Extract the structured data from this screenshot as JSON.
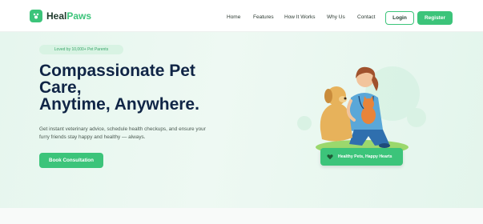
{
  "brand": {
    "name_primary": "Heal",
    "name_accent": "Paws",
    "accent_color": "#3cc47a"
  },
  "nav": {
    "items": [
      {
        "label": "Home"
      },
      {
        "label": "Features"
      },
      {
        "label": "How It Works"
      },
      {
        "label": "Why Us"
      },
      {
        "label": "Contact"
      }
    ],
    "login_label": "Login",
    "register_label": "Register"
  },
  "hero": {
    "badge": "Loved by 10,000+ Pet Parents",
    "headline_line1": "Compassionate Pet",
    "headline_line2": "Care,",
    "headline_line3": "Anytime, Anywhere.",
    "subtext_line1": "Get instant veterinary advice, schedule health checkups, and ensure your",
    "subtext_line2": "furry friends stay happy and healthy — always.",
    "cta_label": "Book Consultation",
    "chip_label": "Healthy Pets, Happy Hearts",
    "chip_icon": "heart-icon"
  },
  "colors": {
    "heading": "#102546",
    "bg_hero": "#e6f6ee",
    "button": "#3cc47a"
  }
}
